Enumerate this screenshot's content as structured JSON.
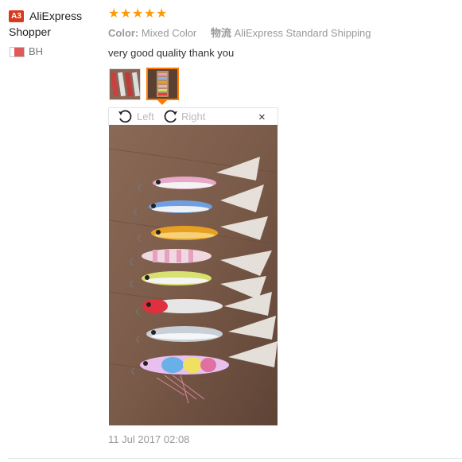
{
  "user": {
    "badge": "A3",
    "name_line1": "AliExpress",
    "name_line2": "Shopper",
    "country": "BH"
  },
  "review": {
    "rating": 5,
    "stars": [
      "★",
      "★",
      "★",
      "★",
      "★"
    ],
    "color_label": "Color:",
    "color_value": "Mixed Color",
    "shipping_label": "物流",
    "shipping_value": "AliExpress Standard Shipping",
    "text": "very good quality thank you",
    "date": "11 Jul 2017 02:08"
  },
  "viewer": {
    "rotate_left_label": "Left",
    "rotate_right_label": "Right",
    "close_label": "×",
    "selected_thumbnail": 2
  },
  "colors": {
    "star": "#ff9a00",
    "badge": "#d7391c",
    "selected_border": "#ff7a00"
  }
}
